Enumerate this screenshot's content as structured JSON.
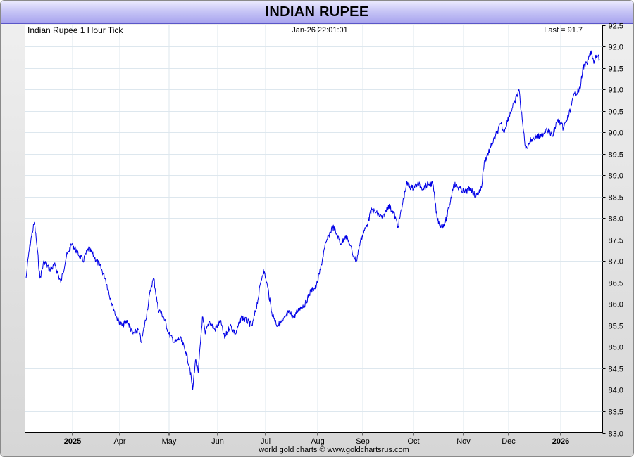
{
  "title": "INDIAN RUPEE",
  "header": {
    "left": "Indian Rupee 1 Hour Tick",
    "center": "Jan-26  22:01:01",
    "right": "Last = 91.7"
  },
  "footer": "world gold charts © www.goldchartsrus.com",
  "colors": {
    "series": "#0000e6",
    "title_band": "#b9b6f2",
    "grid": "#dde7ee"
  },
  "chart_data": {
    "type": "line",
    "title": "Indian Rupee 1 Hour Tick",
    "ylim": [
      83.0,
      92.5
    ],
    "y_ticks": [
      "92.5",
      "92.0",
      "91.5",
      "91.0",
      "90.5",
      "90.0",
      "89.5",
      "89.0",
      "88.5",
      "88.0",
      "87.5",
      "87.0",
      "86.5",
      "86.0",
      "85.5",
      "85.0",
      "84.5",
      "84.0",
      "83.5",
      "83.0"
    ],
    "x_axis_labels": [
      {
        "label": "2025",
        "year": true
      },
      {
        "label": "Apr",
        "year": false
      },
      {
        "label": "May",
        "year": false
      },
      {
        "label": "Jun",
        "year": false
      },
      {
        "label": "Jul",
        "year": false
      },
      {
        "label": "Aug",
        "year": false
      },
      {
        "label": "Sep",
        "year": false
      },
      {
        "label": "Oct",
        "year": false
      },
      {
        "label": "Nov",
        "year": false
      },
      {
        "label": "Dec",
        "year": false
      },
      {
        "label": "2026",
        "year": true
      }
    ],
    "grid": true,
    "series": [
      {
        "points": [
          [
            "2024-12-09",
            86.6
          ],
          [
            "2024-12-11",
            87.2
          ],
          [
            "2024-12-13",
            87.6
          ],
          [
            "2024-12-15",
            87.9
          ],
          [
            "2024-12-17",
            87.3
          ],
          [
            "2024-12-19",
            86.6
          ],
          [
            "2024-12-22",
            87.0
          ],
          [
            "2024-12-26",
            86.8
          ],
          [
            "2024-12-30",
            86.9
          ],
          [
            "2025-01-03",
            86.5
          ],
          [
            "2025-01-07",
            87.1
          ],
          [
            "2025-01-11",
            87.4
          ],
          [
            "2025-01-15",
            87.2
          ],
          [
            "2025-01-19",
            87.0
          ],
          [
            "2025-01-23",
            87.3
          ],
          [
            "2025-01-27",
            87.1
          ],
          [
            "2025-01-31",
            86.9
          ],
          [
            "2025-02-04",
            86.6
          ],
          [
            "2025-02-08",
            86.1
          ],
          [
            "2025-02-12",
            85.7
          ],
          [
            "2025-02-16",
            85.5
          ],
          [
            "2025-02-20",
            85.6
          ],
          [
            "2025-02-24",
            85.3
          ],
          [
            "2025-02-28",
            85.4
          ],
          [
            "2025-03-02",
            85.1
          ],
          [
            "2025-03-06",
            85.8
          ],
          [
            "2025-03-09",
            86.4
          ],
          [
            "2025-03-11",
            86.6
          ],
          [
            "2025-03-14",
            85.9
          ],
          [
            "2025-03-18",
            85.7
          ],
          [
            "2025-03-22",
            85.3
          ],
          [
            "2025-03-26",
            85.1
          ],
          [
            "2025-03-30",
            85.2
          ],
          [
            "2025-04-03",
            84.9
          ],
          [
            "2025-04-06",
            84.5
          ],
          [
            "2025-04-08",
            84.0
          ],
          [
            "2025-04-10",
            84.7
          ],
          [
            "2025-04-12",
            84.4
          ],
          [
            "2025-04-15",
            85.7
          ],
          [
            "2025-04-17",
            85.3
          ],
          [
            "2025-04-20",
            85.6
          ],
          [
            "2025-04-24",
            85.4
          ],
          [
            "2025-04-28",
            85.6
          ],
          [
            "2025-05-01",
            85.2
          ],
          [
            "2025-05-05",
            85.5
          ],
          [
            "2025-05-09",
            85.3
          ],
          [
            "2025-05-13",
            85.7
          ],
          [
            "2025-05-17",
            85.6
          ],
          [
            "2025-05-21",
            85.5
          ],
          [
            "2025-05-25",
            86.1
          ],
          [
            "2025-05-27",
            86.5
          ],
          [
            "2025-05-29",
            86.8
          ],
          [
            "2025-06-01",
            86.4
          ],
          [
            "2025-06-04",
            85.8
          ],
          [
            "2025-06-08",
            85.5
          ],
          [
            "2025-06-12",
            85.6
          ],
          [
            "2025-06-16",
            85.8
          ],
          [
            "2025-06-20",
            85.7
          ],
          [
            "2025-06-24",
            85.9
          ],
          [
            "2025-06-28",
            86.0
          ],
          [
            "2025-07-02",
            86.3
          ],
          [
            "2025-07-06",
            86.4
          ],
          [
            "2025-07-09",
            86.8
          ],
          [
            "2025-07-12",
            87.3
          ],
          [
            "2025-07-15",
            87.6
          ],
          [
            "2025-07-18",
            87.8
          ],
          [
            "2025-07-21",
            87.6
          ],
          [
            "2025-07-24",
            87.4
          ],
          [
            "2025-07-27",
            87.6
          ],
          [
            "2025-07-30",
            87.4
          ],
          [
            "2025-08-02",
            87.1
          ],
          [
            "2025-08-04",
            87.0
          ],
          [
            "2025-08-07",
            87.5
          ],
          [
            "2025-08-11",
            87.8
          ],
          [
            "2025-08-15",
            88.2
          ],
          [
            "2025-08-19",
            88.1
          ],
          [
            "2025-08-23",
            88.0
          ],
          [
            "2025-08-27",
            88.3
          ],
          [
            "2025-08-31",
            88.1
          ],
          [
            "2025-09-03",
            87.8
          ],
          [
            "2025-09-06",
            88.3
          ],
          [
            "2025-09-09",
            88.8
          ],
          [
            "2025-09-13",
            88.7
          ],
          [
            "2025-09-17",
            88.8
          ],
          [
            "2025-09-21",
            88.7
          ],
          [
            "2025-09-25",
            88.8
          ],
          [
            "2025-09-28",
            88.8
          ],
          [
            "2025-10-01",
            88.0
          ],
          [
            "2025-10-04",
            87.8
          ],
          [
            "2025-10-07",
            87.9
          ],
          [
            "2025-10-10",
            88.3
          ],
          [
            "2025-10-13",
            88.8
          ],
          [
            "2025-10-17",
            88.7
          ],
          [
            "2025-10-21",
            88.6
          ],
          [
            "2025-10-25",
            88.7
          ],
          [
            "2025-10-29",
            88.5
          ],
          [
            "2025-11-02",
            88.7
          ],
          [
            "2025-11-04",
            89.3
          ],
          [
            "2025-11-08",
            89.6
          ],
          [
            "2025-11-12",
            89.9
          ],
          [
            "2025-11-16",
            90.2
          ],
          [
            "2025-11-18",
            90.0
          ],
          [
            "2025-11-22",
            90.4
          ],
          [
            "2025-11-26",
            90.7
          ],
          [
            "2025-11-29",
            91.0
          ],
          [
            "2025-12-02",
            90.1
          ],
          [
            "2025-12-04",
            89.6
          ],
          [
            "2025-12-07",
            89.8
          ],
          [
            "2025-12-11",
            89.9
          ],
          [
            "2025-12-15",
            89.9
          ],
          [
            "2025-12-19",
            90.1
          ],
          [
            "2025-12-23",
            89.9
          ],
          [
            "2025-12-27",
            90.3
          ],
          [
            "2025-12-31",
            90.1
          ],
          [
            "2026-01-04",
            90.4
          ],
          [
            "2026-01-08",
            90.9
          ],
          [
            "2026-01-12",
            91.0
          ],
          [
            "2026-01-14",
            91.5
          ],
          [
            "2026-01-17",
            91.6
          ],
          [
            "2026-01-20",
            91.9
          ],
          [
            "2026-01-22",
            91.6
          ],
          [
            "2026-01-24",
            91.8
          ],
          [
            "2026-01-26",
            91.7
          ]
        ]
      }
    ]
  }
}
